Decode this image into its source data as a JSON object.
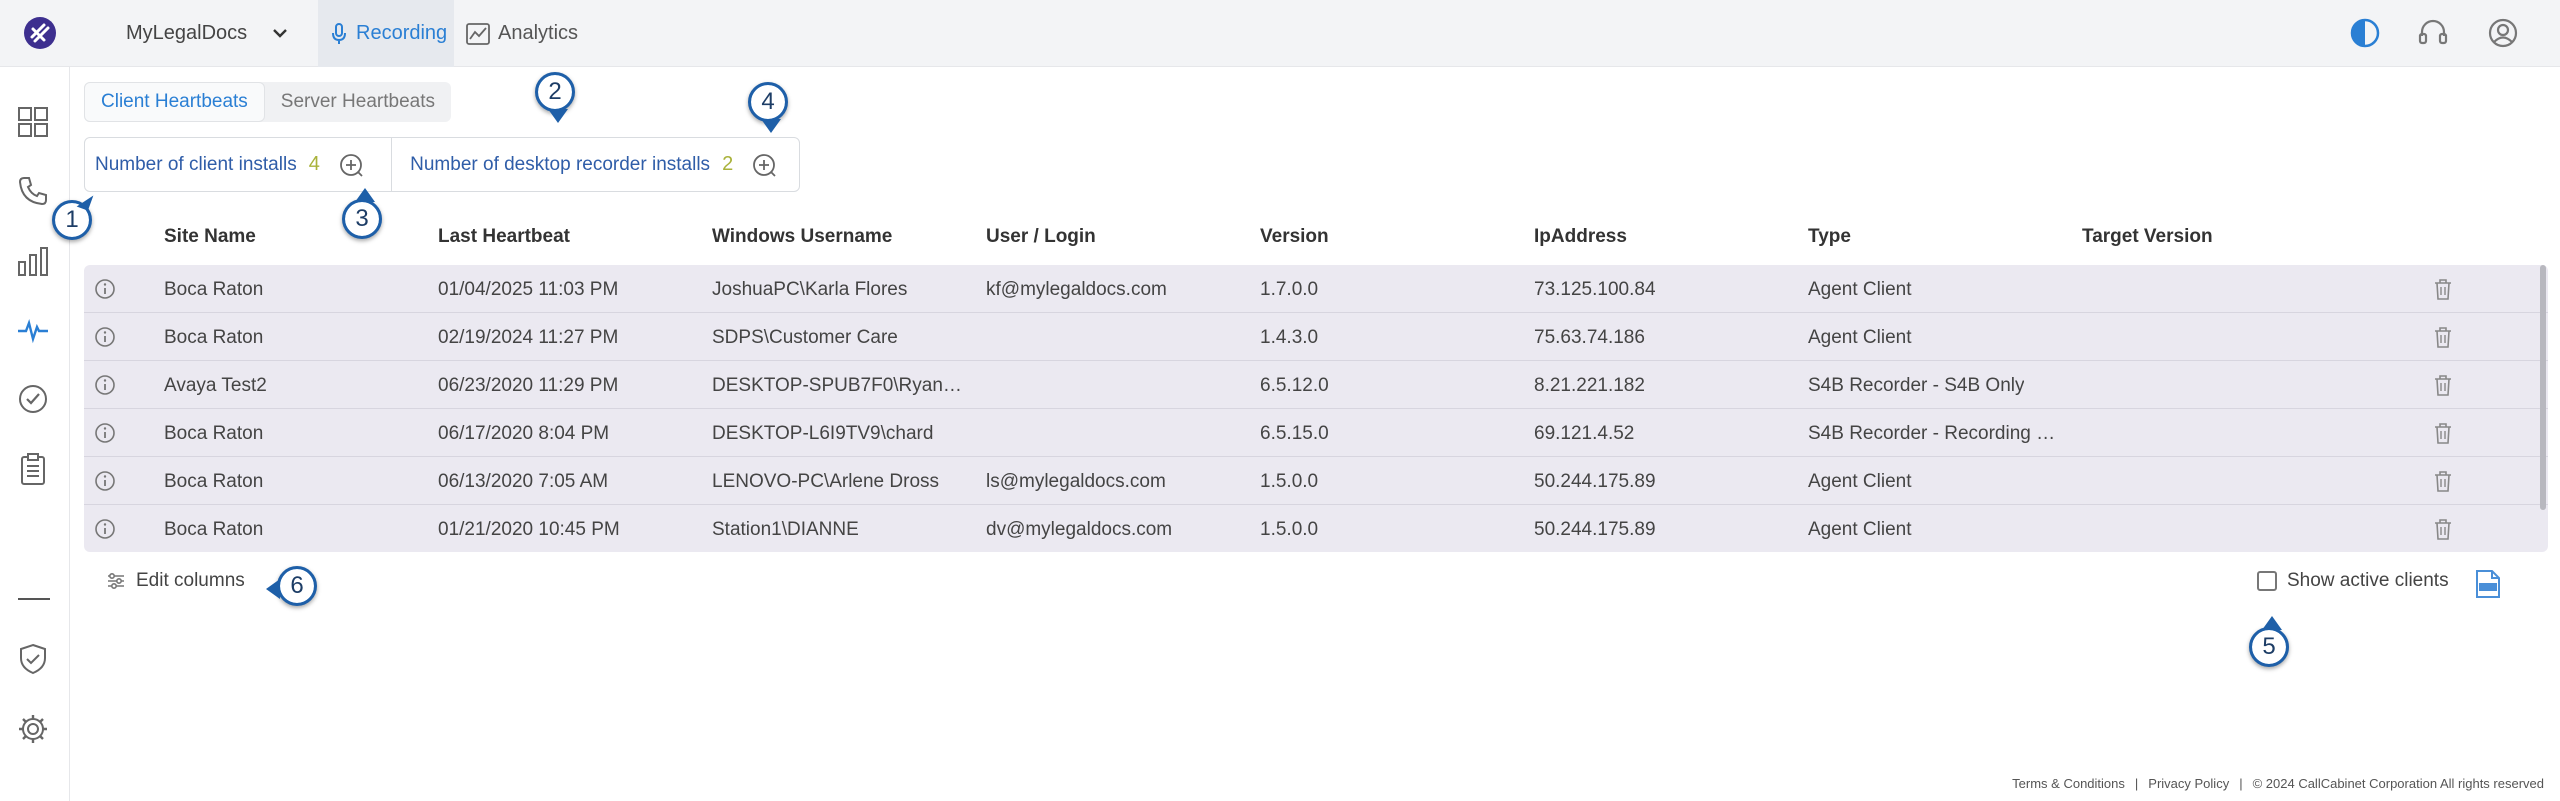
{
  "app": {
    "workspace": "MyLegalDocs",
    "nav": {
      "recording": "Recording",
      "analytics": "Analytics"
    }
  },
  "subtabs": {
    "client": "Client Heartbeats",
    "server": "Server Heartbeats"
  },
  "counters": {
    "client_label": "Number of client installs",
    "client_count": "4",
    "desktop_label": "Number of desktop recorder installs",
    "desktop_count": "2"
  },
  "table": {
    "columns": [
      "Site Name",
      "Last Heartbeat",
      "Windows Username",
      "User / Login",
      "Version",
      "IpAddress",
      "Type",
      "Target Version"
    ],
    "rows": [
      {
        "site": "Boca Raton",
        "heartbeat": "01/04/2025 11:03 PM",
        "username": "JoshuaPC\\Karla Flores",
        "login": "kf@mylegaldocs.com",
        "version": "1.7.0.0",
        "ip": "73.125.100.84",
        "type": "Agent Client",
        "target": ""
      },
      {
        "site": "Boca Raton",
        "heartbeat": "02/19/2024 11:27 PM",
        "username": "SDPS\\Customer Care",
        "login": "",
        "version": "1.4.3.0",
        "ip": "75.63.74.186",
        "type": "Agent Client",
        "target": ""
      },
      {
        "site": "Avaya Test2",
        "heartbeat": "06/23/2020 11:29 PM",
        "username": "DESKTOP-SPUB7F0\\Ryan …",
        "login": "",
        "version": "6.5.12.0",
        "ip": "8.21.221.182",
        "type": "S4B Recorder - S4B Only",
        "target": ""
      },
      {
        "site": "Boca Raton",
        "heartbeat": "06/17/2020 8:04 PM",
        "username": "DESKTOP-L6I9TV9\\chard",
        "login": "",
        "version": "6.5.15.0",
        "ip": "69.121.4.52",
        "type": "S4B Recorder - Recording d…",
        "target": ""
      },
      {
        "site": "Boca Raton",
        "heartbeat": "06/13/2020 7:05 AM",
        "username": "LENOVO-PC\\Arlene Dross",
        "login": "ls@mylegaldocs.com",
        "version": "1.5.0.0",
        "ip": "50.244.175.89",
        "type": "Agent Client",
        "target": ""
      },
      {
        "site": "Boca Raton",
        "heartbeat": "01/21/2020 10:45 PM",
        "username": "Station1\\DIANNE",
        "login": "dv@mylegaldocs.com",
        "version": "1.5.0.0",
        "ip": "50.244.175.89",
        "type": "Agent Client",
        "target": ""
      }
    ]
  },
  "controls": {
    "edit_columns": "Edit columns",
    "show_active": "Show active clients"
  },
  "footer": {
    "terms": "Terms & Conditions",
    "sep": "|",
    "privacy": "Privacy Policy",
    "copyright": "© 2024 CallCabinet Corporation All rights reserved"
  },
  "callouts": [
    "1",
    "2",
    "3",
    "4",
    "5",
    "6"
  ],
  "icons": {
    "logo": "callcabinet-logo-icon",
    "sidebar": [
      "dashboard-icon",
      "phone-icon",
      "bar-chart-icon",
      "heartbeat-icon",
      "check-circle-icon",
      "clipboard-icon",
      "divider",
      "shield-icon",
      "gear-icon"
    ]
  },
  "colors": {
    "accent": "#2a7fd4",
    "count": "#a9b23a",
    "row_bg": "#ebe9f1",
    "callout": "#5b9fdc"
  }
}
